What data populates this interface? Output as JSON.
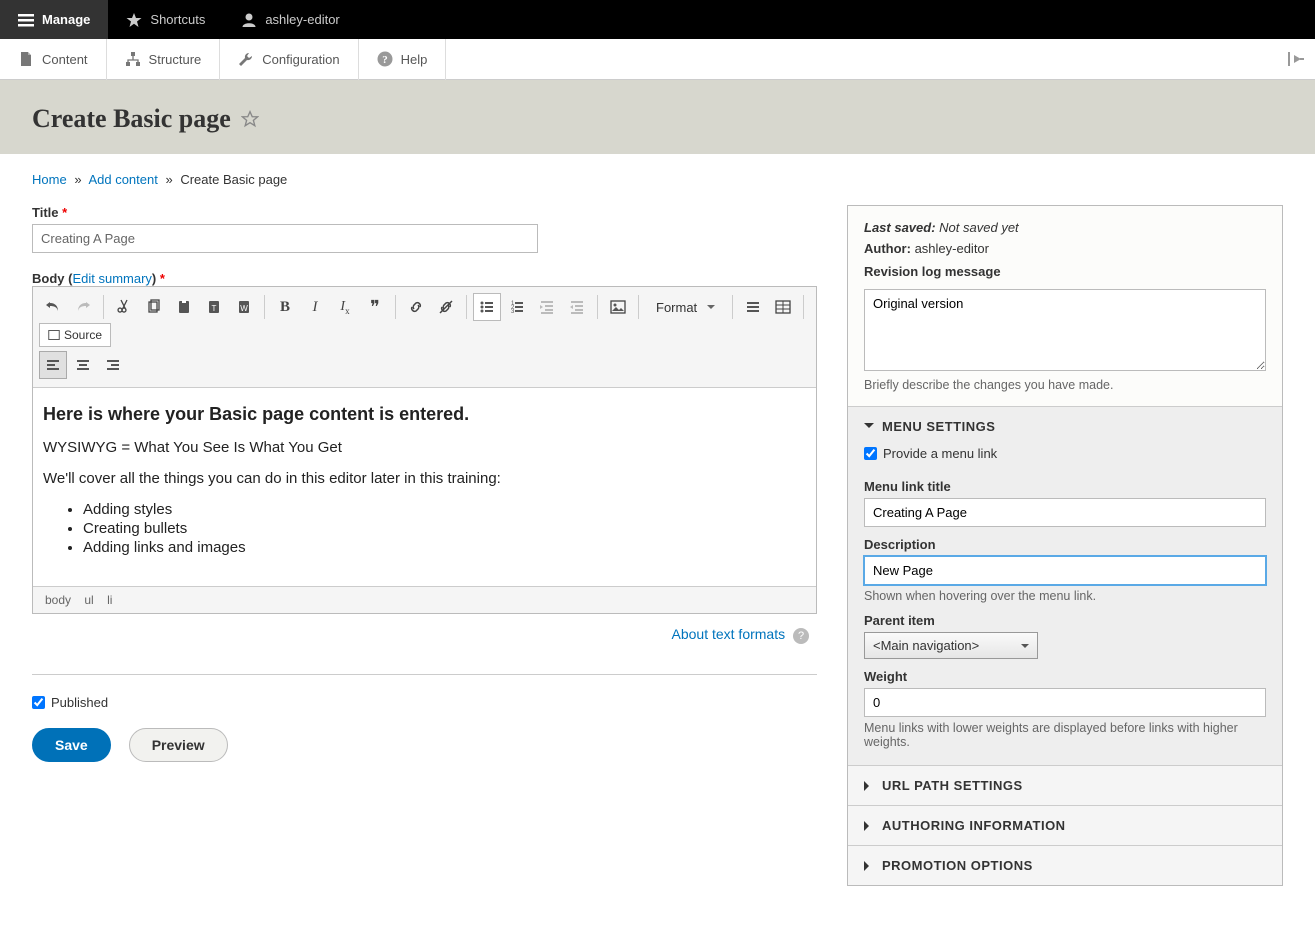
{
  "topbar": {
    "manage": "Manage",
    "shortcuts": "Shortcuts",
    "user": "ashley-editor"
  },
  "subbar": {
    "content": "Content",
    "structure": "Structure",
    "configuration": "Configuration",
    "help": "Help"
  },
  "page_title": "Create Basic page",
  "breadcrumb": {
    "home": "Home",
    "add_content": "Add content",
    "current": "Create Basic page"
  },
  "form": {
    "title_label": "Title",
    "title_value": "Creating A Page",
    "body_label": "Body",
    "edit_summary": "Edit summary",
    "published_label": "Published",
    "save": "Save",
    "preview": "Preview"
  },
  "editor": {
    "format_select": "Format",
    "source": "Source",
    "content_heading": "Here is where your Basic page content is entered.",
    "content_p1": "WYSIWYG = What You See Is What You Get",
    "content_p2": "We'll cover all the things you can do in this editor later in this training:",
    "bullets": [
      "Adding styles",
      "Creating bullets",
      "Adding links and images"
    ],
    "path": [
      "body",
      "ul",
      "li"
    ],
    "about_formats": "About text formats"
  },
  "sidebar": {
    "last_saved_label": "Last saved:",
    "last_saved_value": "Not saved yet",
    "author_label": "Author:",
    "author_value": "ashley-editor",
    "revision_label": "Revision log message",
    "revision_value": "Original version",
    "revision_help": "Briefly describe the changes you have made.",
    "menu_settings": {
      "header": "MENU SETTINGS",
      "provide_link": "Provide a menu link",
      "link_title_label": "Menu link title",
      "link_title_value": "Creating A Page",
      "description_label": "Description",
      "description_value": "New Page",
      "description_help": "Shown when hovering over the menu link.",
      "parent_label": "Parent item",
      "parent_value": "<Main navigation>",
      "weight_label": "Weight",
      "weight_value": "0",
      "weight_help": "Menu links with lower weights are displayed before links with higher weights."
    },
    "url_path": "URL PATH SETTINGS",
    "authoring": "AUTHORING INFORMATION",
    "promotion": "PROMOTION OPTIONS"
  }
}
